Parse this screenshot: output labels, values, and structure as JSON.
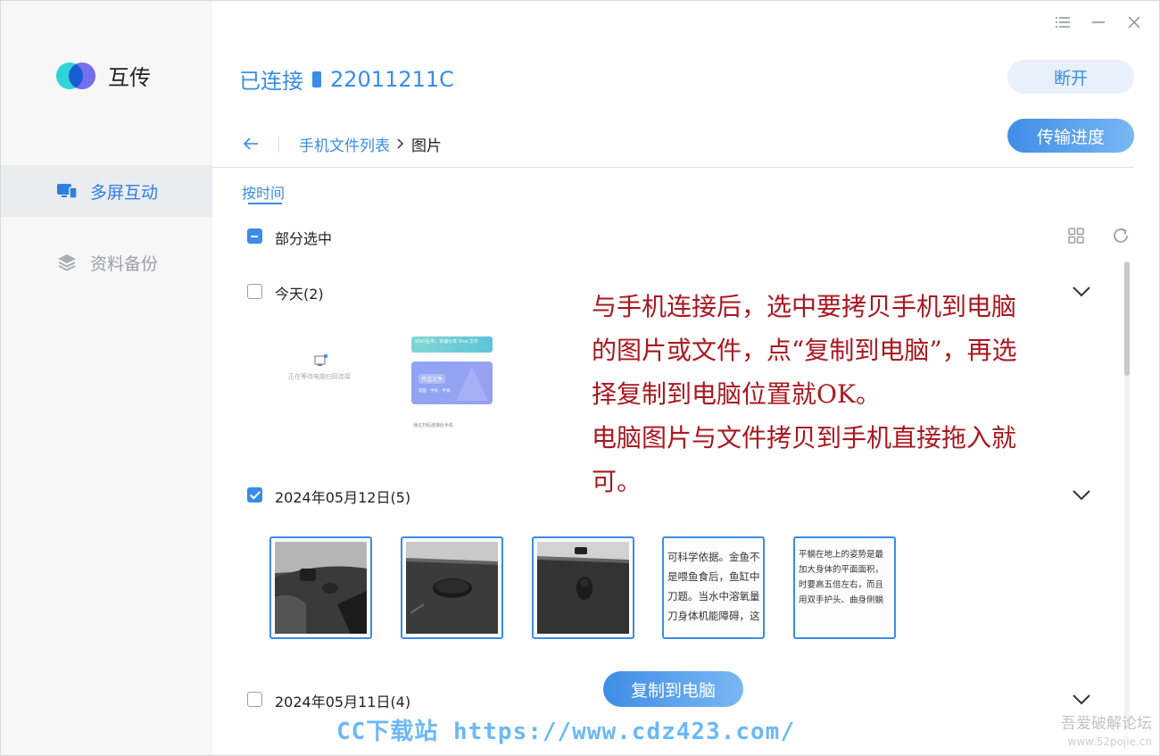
{
  "app": {
    "name": "互传"
  },
  "sidebar": {
    "items": [
      {
        "label": "多屏互动",
        "icon": "monitor-icon",
        "active": true
      },
      {
        "label": "资料备份",
        "icon": "layers-icon",
        "active": false
      }
    ]
  },
  "titlebar": {
    "icons": [
      "menu-icon",
      "minimize-icon",
      "close-icon"
    ]
  },
  "header": {
    "status": "已连接",
    "device_icon": "phone-icon",
    "device": "22011211C",
    "disconnect_label": "断开",
    "progress_label": "传输进度"
  },
  "breadcrumb": {
    "parent": "手机文件列表",
    "current": "图片"
  },
  "tabs": {
    "by_time": "按时间"
  },
  "selection": {
    "label": "部分选中",
    "state": "partial"
  },
  "tools": [
    "grid-view-icon",
    "refresh-icon"
  ],
  "groups": [
    {
      "label": "今天(2)",
      "checked": false
    },
    {
      "label": "2024年05月12日(5)",
      "checked": true
    },
    {
      "label": "2024年05月11日(4)",
      "checked": false
    }
  ],
  "today_thumbs": {
    "thumb1_text": "正在等待电脑扫码连接",
    "thumb2_header": "VIVO互传，快速分享 Vivo 文件",
    "thumb2_card": "传送文件",
    "thumb2_sub": "电脑 · 手机 · 平板",
    "thumb2_footer": "通过扫码连接此手机"
  },
  "text_thumbs": {
    "t1": [
      "可科学依据。金鱼不",
      "是喂鱼食后，鱼缸中",
      "刀题。当水中溶氧量",
      "刀身体机能障碍，这"
    ],
    "t2": [
      "平躺在地上的姿势是最",
      "加大身体的平面面积，",
      "时要高五倍左右，而且",
      "用双手护头、曲身侧躺"
    ]
  },
  "overlay": {
    "line1": "与手机连接后，选中要拷贝手机到电脑的图片或文件，点“复制到电脑”，再选择复制到电脑位置就OK。",
    "line2": "电脑图片与文件拷贝到手机直接拖入就可。"
  },
  "copy_button_label": "复制到电脑",
  "watermarks": {
    "left": "CC下载站 https://www.cdz423.com/",
    "right_main": "吾爱破解论坛",
    "right_sub": "www.52pojie.cn"
  },
  "colors": {
    "accent": "#3a8ce6",
    "overlay_text": "#a8181f"
  }
}
